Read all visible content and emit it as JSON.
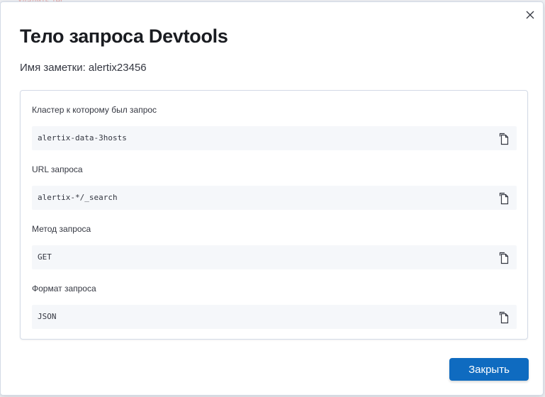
{
  "background": {
    "partial_text": "Удалить тег"
  },
  "modal": {
    "title": "Тело запроса Devtools",
    "subtitle": "Имя заметки: alertix23456",
    "close_icon": "close-icon",
    "fields": [
      {
        "label": "Кластер к которому был запрос",
        "value": "alertix-data-3hosts",
        "copy_icon": "copy-icon"
      },
      {
        "label": "URL запроса",
        "value": "alertix-*/_search",
        "copy_icon": "copy-icon"
      },
      {
        "label": "Метод запроса",
        "value": "GET",
        "copy_icon": "copy-icon"
      },
      {
        "label": "Формат запроса",
        "value": "JSON",
        "copy_icon": "copy-icon"
      }
    ],
    "close_button_label": "Закрыть",
    "accent_color": "#0f6bc0"
  }
}
